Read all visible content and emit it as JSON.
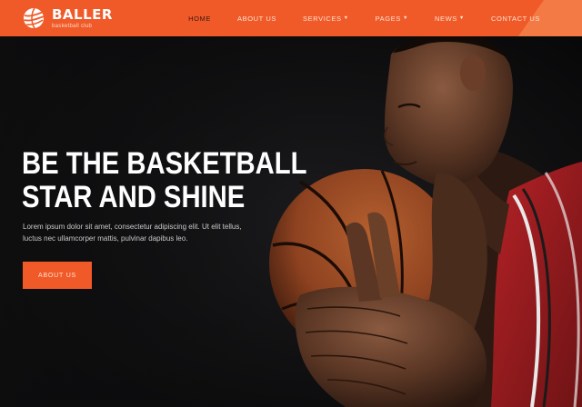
{
  "brand": {
    "name": "BALLER",
    "tagline": "basketball club",
    "logo_icon": "basketball-logo-icon"
  },
  "nav": [
    {
      "label": "HOME",
      "active": true,
      "dropdown": false
    },
    {
      "label": "ABOUT US",
      "active": false,
      "dropdown": false
    },
    {
      "label": "SERVICES",
      "active": false,
      "dropdown": true
    },
    {
      "label": "PAGES",
      "active": false,
      "dropdown": true
    },
    {
      "label": "NEWS",
      "active": false,
      "dropdown": true
    },
    {
      "label": "CONTACT US",
      "active": false,
      "dropdown": false
    }
  ],
  "nav_caret_icon": "chevron-down-icon",
  "hero": {
    "title_line1": "BE THE BASKETBALL",
    "title_line2": "STAR AND SHINE",
    "text": "Lorem ipsum dolor sit amet, consectetur adipiscing elit. Ut elit tellus, luctus nec ullamcorper mattis, pulvinar dapibus leo.",
    "button_label": "ABOUT US",
    "image": "basketball-player-photo"
  },
  "colors": {
    "accent": "#f05a28",
    "background": "#0e0e0f",
    "jersey": "#c2262a",
    "ball": "#a34c24"
  }
}
